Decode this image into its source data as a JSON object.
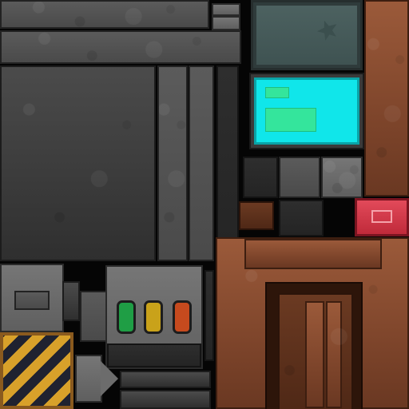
{
  "sheet": {
    "kind": "sprite-atlas",
    "theme": "sci-fi metal and rust tiles",
    "colors": {
      "metal_dark": "#3c3c3c",
      "metal_light": "#6a6a6a",
      "rust": "#8a4c30",
      "screen_cyan": "#10e6ea",
      "screen_cyan_text": "#34e59c",
      "lamp_green": "#1f9e45",
      "lamp_yellow": "#c9a21a",
      "lamp_orange": "#c64a1e",
      "hazard_yellow": "#d8a12a",
      "hazard_dark": "#1f2230",
      "warning_red": "#d23a4a"
    },
    "icons": [
      "chevron-right-icon",
      "stamp-icon",
      "checkmark-box-icon"
    ]
  }
}
